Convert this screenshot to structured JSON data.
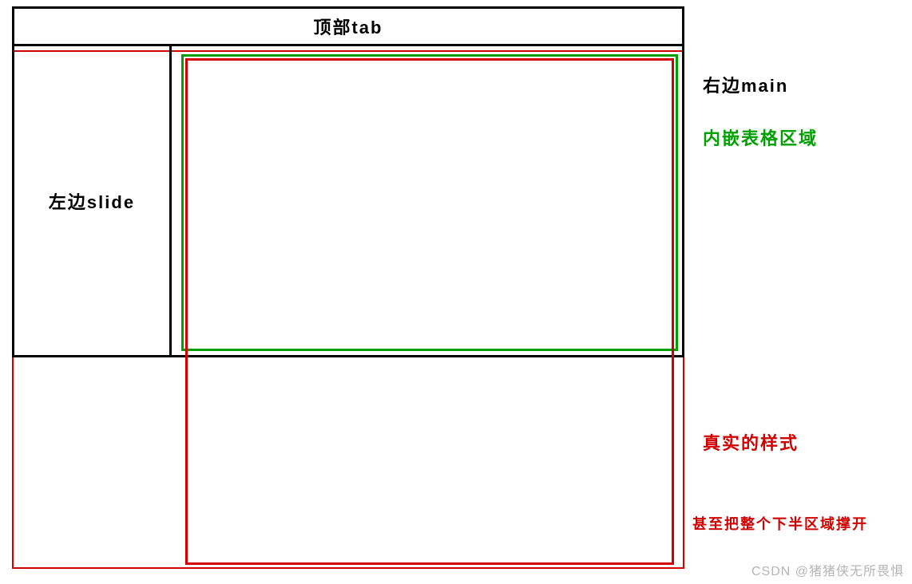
{
  "regions": {
    "top_tab_label": "顶部tab",
    "left_slide_label": "左边slide"
  },
  "annotations": {
    "right_main": "右边main",
    "inner_table_area": "内嵌表格区域",
    "real_style": "真实的样式",
    "overflow_note": "甚至把整个下半区域撑开"
  },
  "watermark": "CSDN @猪猪侠无所畏惧"
}
